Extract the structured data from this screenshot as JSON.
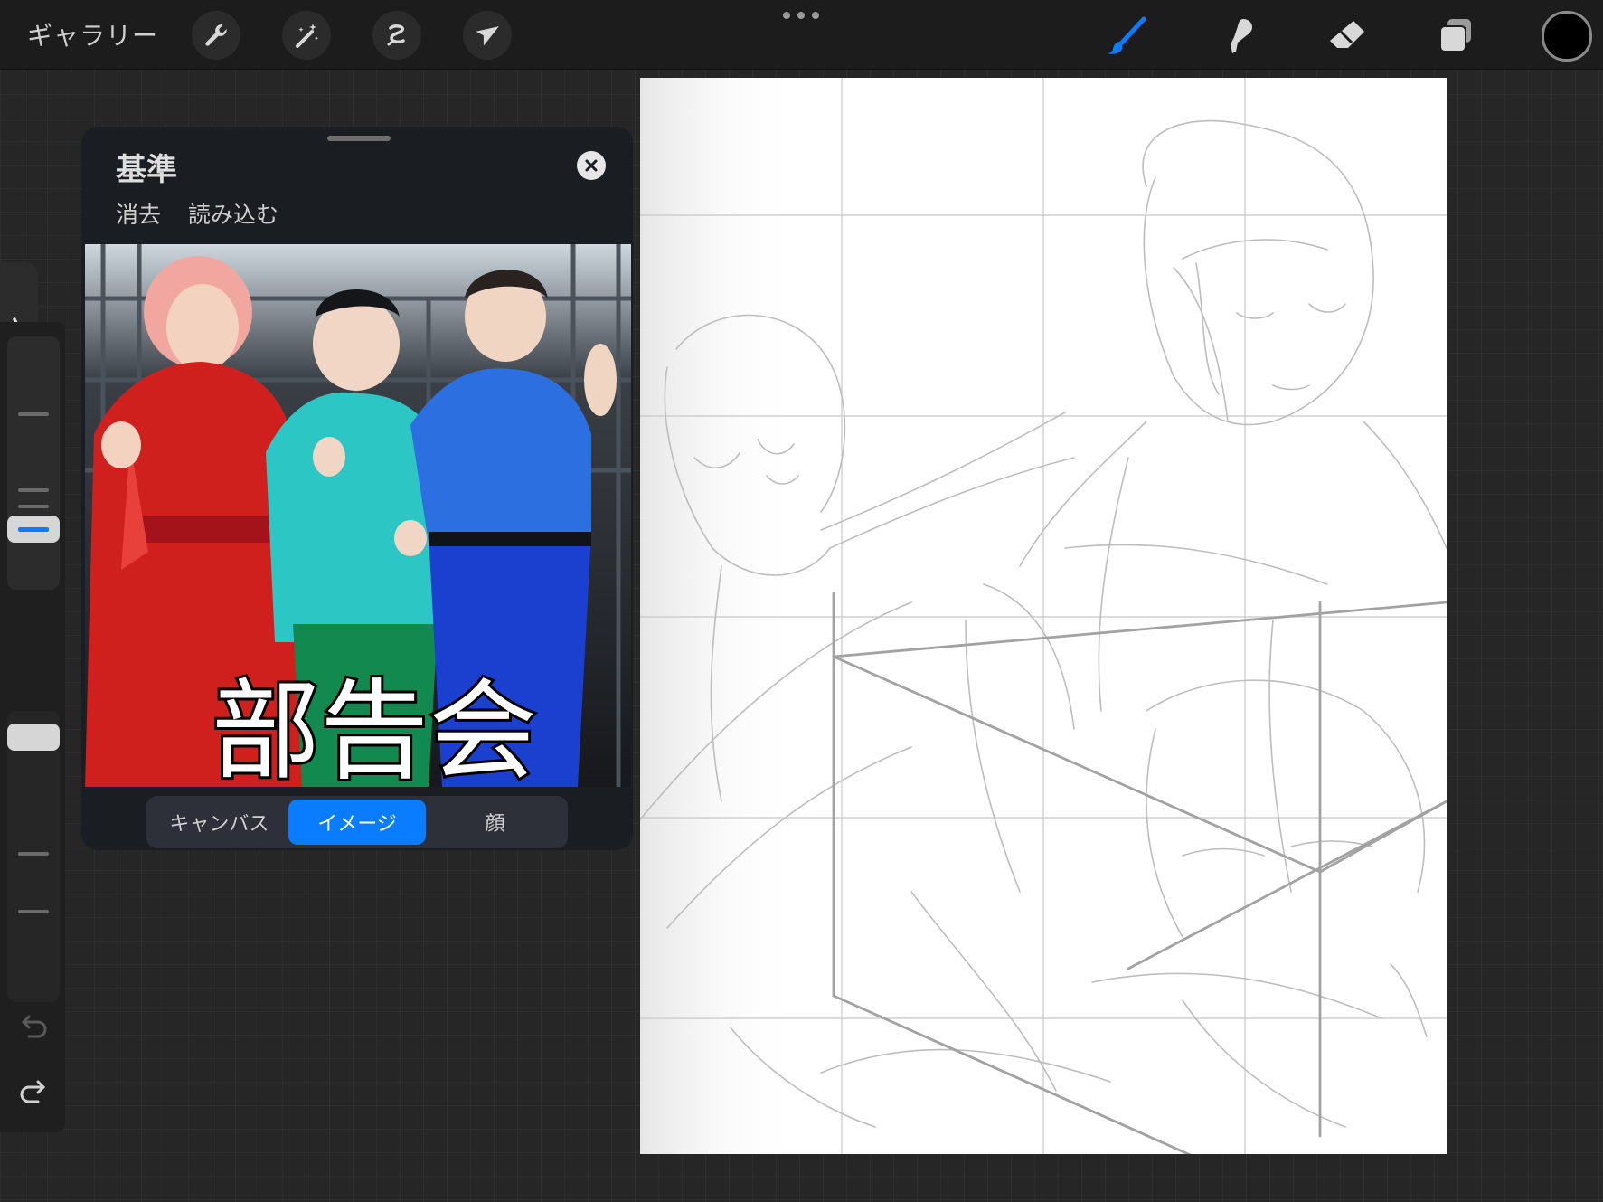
{
  "topbar": {
    "gallery_label": "ギャラリー",
    "left_tools": [
      "wrench-icon",
      "magic-wand-icon",
      "selection-icon",
      "move-arrow-icon"
    ],
    "right_tools": [
      "brush-icon",
      "smudge-icon",
      "eraser-icon",
      "layers-icon"
    ],
    "active_tool": "brush-icon",
    "current_color": "#000000",
    "accent_color": "#0a7cff"
  },
  "reference_panel": {
    "title": "基準",
    "clear_label": "消去",
    "import_label": "読み込む",
    "image_caption": "部告会",
    "segments": [
      {
        "label": "キャンバス",
        "active": false
      },
      {
        "label": "イメージ",
        "active": true
      },
      {
        "label": "顔",
        "active": false
      }
    ]
  },
  "sidebar": {
    "icons": [
      "undo-icon",
      "redo-icon"
    ],
    "brush_size_level": 0.78,
    "opacity_level": 0.0
  }
}
